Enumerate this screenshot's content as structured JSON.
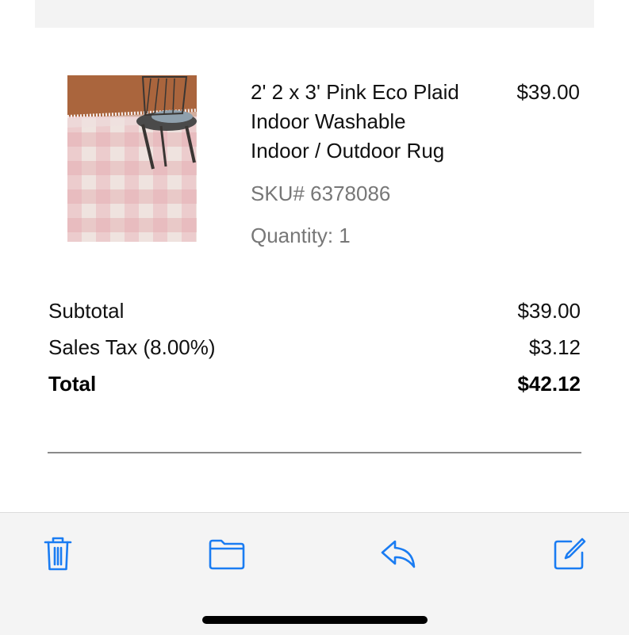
{
  "product": {
    "name_lines": [
      "2' 2 x 3' Pink Eco Plaid",
      "Indoor Washable",
      "Indoor / Outdoor Rug"
    ],
    "price": "$39.00",
    "sku": "SKU# 6378086",
    "quantity": "Quantity: 1"
  },
  "summary": {
    "subtotal_label": "Subtotal",
    "subtotal_value": "$39.00",
    "tax_label": "Sales Tax (8.00%)",
    "tax_value": "$3.12",
    "total_label": "Total",
    "total_value": "$42.12"
  },
  "toolbar": {
    "icons": [
      "trash-icon",
      "folder-icon",
      "reply-icon",
      "compose-icon"
    ],
    "accent_color": "#1a7cf2"
  }
}
